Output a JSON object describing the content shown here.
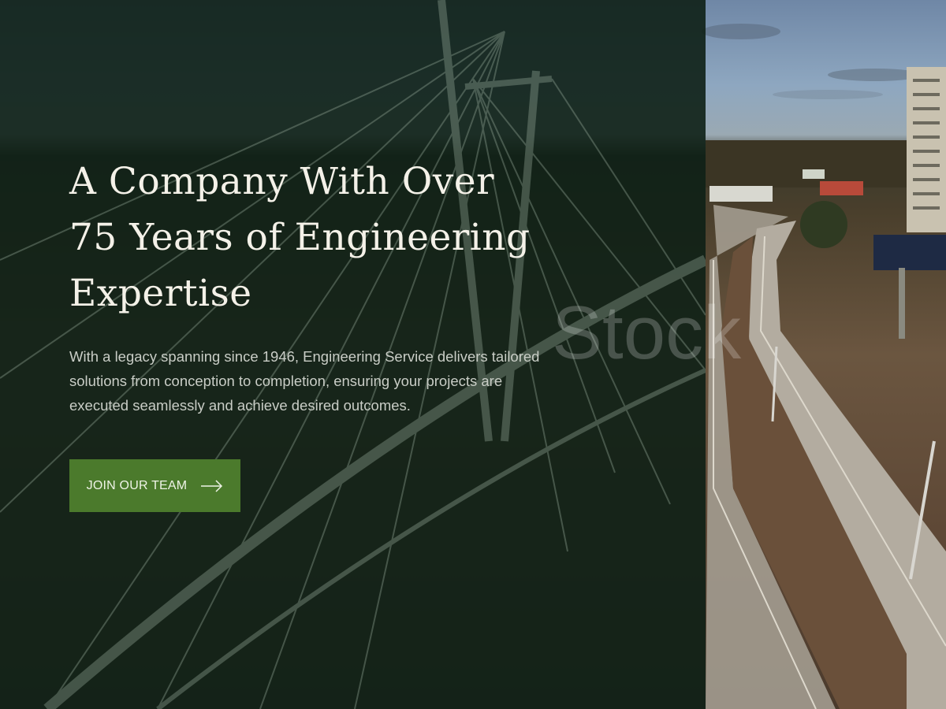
{
  "hero": {
    "headline_lines": [
      "A Company With Over",
      "75 Years of Engineering",
      "Expertise"
    ],
    "description": "With a legacy spanning since 1946, Engineering Service delivers tailored solutions from conception to completion, ensuring your projects are executed seamlessly and achieve desired outcomes.",
    "cta_label": "JOIN OUR TEAM",
    "cta_icon": "arrow-right-icon",
    "watermark": "Stock"
  },
  "colors": {
    "overlay": "#0e2016",
    "accent": "#4b7a2c",
    "heading_text": "#f4f1e8",
    "body_text": "#c9cdc6"
  }
}
